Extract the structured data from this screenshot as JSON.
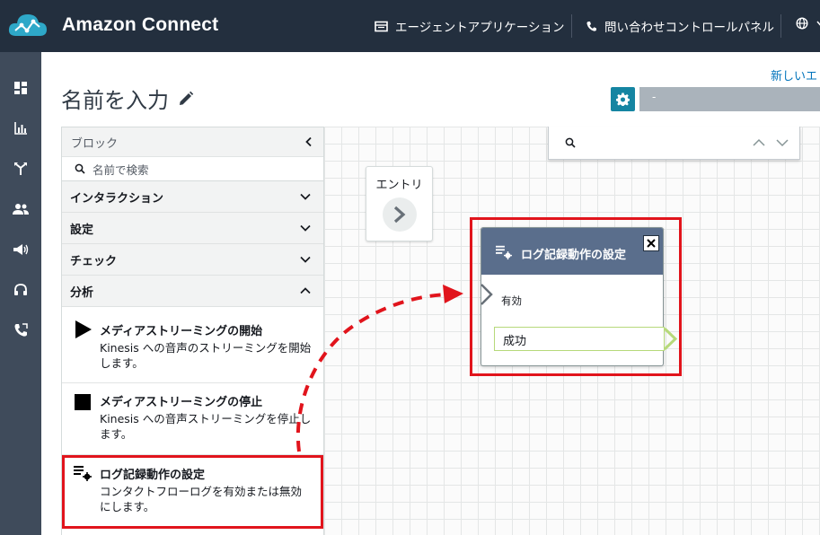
{
  "app": {
    "title": "Amazon Connect",
    "nav_links": [
      "エージェントアプリケーション",
      "問い合わせコントロールパネル"
    ]
  },
  "page": {
    "title": "名前を入力",
    "new_link": "新しいエ",
    "dropdown_value": "-"
  },
  "panel": {
    "header": "ブロック",
    "search_placeholder": "名前で検索",
    "categories": [
      "インタラクション",
      "設定",
      "チェック",
      "分析"
    ],
    "blocks": [
      {
        "title": "メディアストリーミングの開始",
        "desc_line1": "Kinesis への音声のストリーミングを開始",
        "desc_line2": "します。"
      },
      {
        "title": "メディアストリーミングの停止",
        "desc_line1": "Kinesis への音声ストリーミングを停止し",
        "desc_line2": "ます。"
      },
      {
        "title": "ログ記録動作の設定",
        "desc_line1": "コンタクトフローログを有効または無効",
        "desc_line2": "にします。"
      }
    ]
  },
  "canvas": {
    "entry_label": "エントリ",
    "node": {
      "title": "ログ記録動作の設定",
      "input_label": "有効",
      "branch_label": "成功"
    }
  },
  "colors": {
    "topbar": "#232f3e",
    "leftnav": "#3f4b5b",
    "node_header": "#5a6e8c",
    "highlight": "#e1141c",
    "accent": "#1585a2"
  }
}
